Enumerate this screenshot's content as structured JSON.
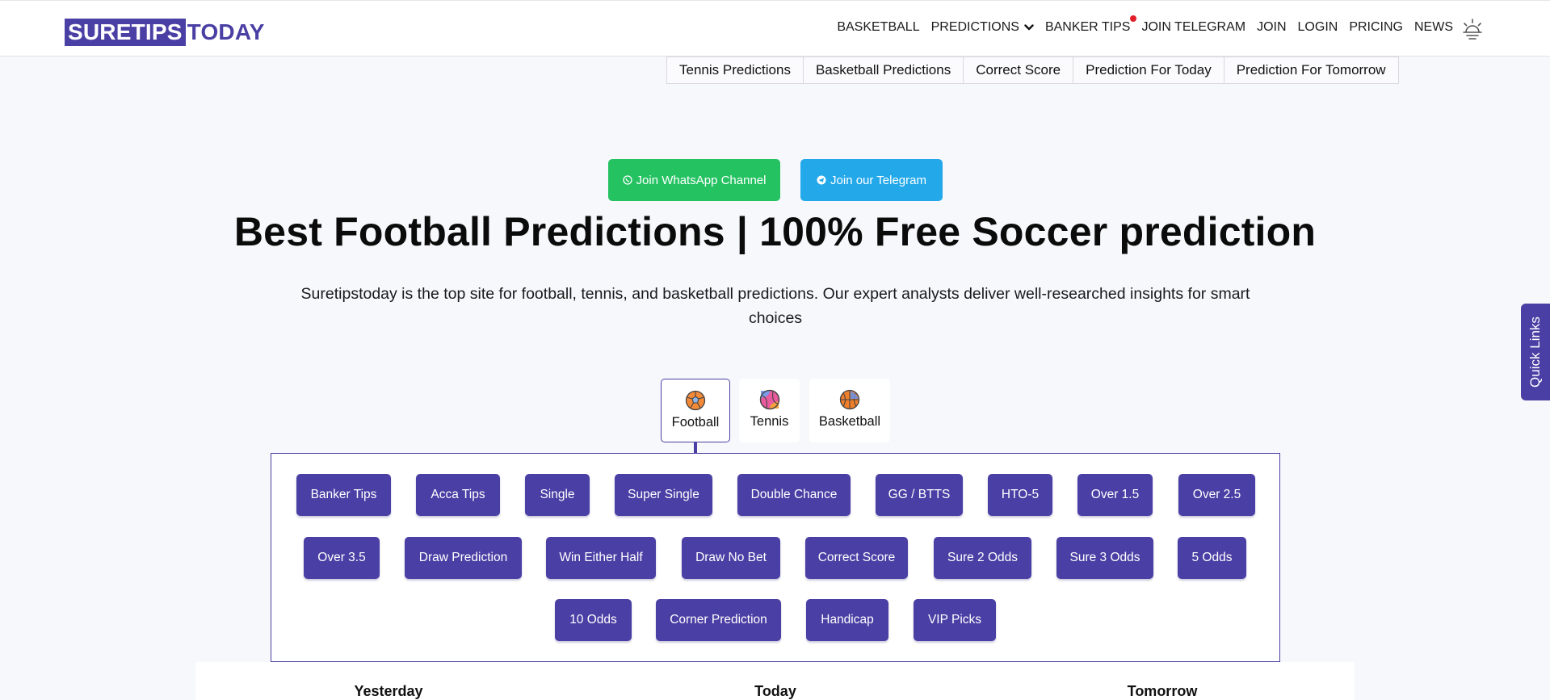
{
  "header": {
    "logo_box": "SURETIPS",
    "logo_tail": "TODAY",
    "nav": [
      "BASKETBALL",
      "PREDICTIONS",
      "BANKER TIPS",
      "JOIN TELEGRAM",
      "JOIN",
      "LOGIN",
      "PRICING",
      "NEWS"
    ]
  },
  "subtabs": [
    "Tennis Predictions",
    "Basketball Predictions",
    "Correct Score",
    "Prediction For Today",
    "Prediction For Tomorrow"
  ],
  "cta": {
    "whatsapp": "Join WhatsApp Channel",
    "telegram": "Join our Telegram"
  },
  "hero": {
    "title": "Best Football Predictions | 100% Free Soccer prediction",
    "lead": "Suretipstoday is the top site for football, tennis, and basketball predictions. Our expert analysts deliver well-researched insights for smart choices"
  },
  "sports": [
    "Football",
    "Tennis",
    "Basketball"
  ],
  "categories": [
    "Banker Tips",
    "Acca Tips",
    "Single",
    "Super Single",
    "Double Chance",
    "GG / BTTS",
    "HTO-5",
    "Over 1.5",
    "Over 2.5",
    "Over 3.5",
    "Draw Prediction",
    "Win Either Half",
    "Draw No Bet",
    "Correct Score",
    "Sure 2 Odds",
    "Sure 3 Odds",
    "5 Odds",
    "10 Odds",
    "Corner Prediction",
    "Handicap",
    "VIP Picks"
  ],
  "days": [
    "Yesterday",
    "Today",
    "Tomorrow"
  ],
  "quick_links": "Quick Links",
  "colors": {
    "brand": "#4a3fa4",
    "whatsapp": "#25c262",
    "telegram": "#23a8ea",
    "notify_dot": "#e11d2a"
  }
}
